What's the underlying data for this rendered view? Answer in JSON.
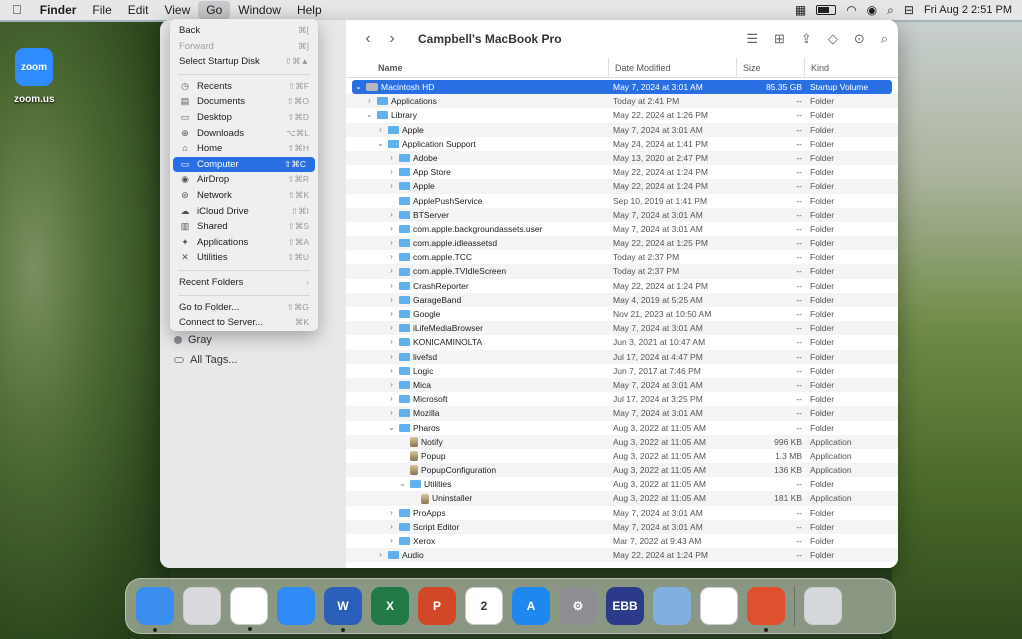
{
  "menubar": {
    "apple": "",
    "app": "Finder",
    "items": [
      "File",
      "Edit",
      "View",
      "Go",
      "Window",
      "Help"
    ],
    "clock": "Fri Aug 2  2:51 PM"
  },
  "desktop": {
    "zoom_icon": "zoom",
    "zoom_label": "zoom.us"
  },
  "go_menu": {
    "items": [
      {
        "label": "Back",
        "shortcut": "⌘[",
        "disabled": false
      },
      {
        "label": "Forward",
        "shortcut": "⌘]",
        "disabled": true
      },
      {
        "label": "Select Startup Disk",
        "shortcut": "⇧⌘▲",
        "disabled": false
      },
      {
        "label": "Recents",
        "shortcut": "⇧⌘F",
        "icon": "clock-icon"
      },
      {
        "label": "Documents",
        "shortcut": "⇧⌘O",
        "icon": "document-icon"
      },
      {
        "label": "Desktop",
        "shortcut": "⇧⌘D",
        "icon": "desktop-icon"
      },
      {
        "label": "Downloads",
        "shortcut": "⌥⌘L",
        "icon": "download-icon"
      },
      {
        "label": "Home",
        "shortcut": "⇧⌘H",
        "icon": "home-icon"
      },
      {
        "label": "Computer",
        "shortcut": "⇧⌘C",
        "icon": "computer-icon"
      },
      {
        "label": "AirDrop",
        "shortcut": "⇧⌘R",
        "icon": "airdrop-icon"
      },
      {
        "label": "Network",
        "shortcut": "⇧⌘K",
        "icon": "network-icon"
      },
      {
        "label": "iCloud Drive",
        "shortcut": "⇧⌘I",
        "icon": "cloud-icon"
      },
      {
        "label": "Shared",
        "shortcut": "⇧⌘S",
        "icon": "shared-icon"
      },
      {
        "label": "Applications",
        "shortcut": "⇧⌘A",
        "icon": "applications-icon"
      },
      {
        "label": "Utilities",
        "shortcut": "⇧⌘U",
        "icon": "utilities-icon"
      },
      {
        "label": "Recent Folders",
        "shortcut": "›"
      },
      {
        "label": "Go to Folder...",
        "shortcut": "⇧⌘G"
      },
      {
        "label": "Connect to Server...",
        "shortcut": "⌘K"
      }
    ]
  },
  "sidebar": {
    "tags": [
      {
        "label": "Gray"
      },
      {
        "label": "All Tags..."
      }
    ]
  },
  "finder": {
    "title": "Campbell's MacBook Pro",
    "columns": {
      "name": "Name",
      "date": "Date Modified",
      "size": "Size",
      "kind": "Kind"
    },
    "rows": [
      {
        "name": "Macintosh HD",
        "indent": 0,
        "chev": "⌄",
        "icon": "hd",
        "date": "May 7, 2024 at 3:01 AM",
        "size": "85.35 GB",
        "kind": "Startup Volume",
        "sel": true
      },
      {
        "name": "Applications",
        "indent": 1,
        "chev": "›",
        "icon": "folder",
        "date": "Today at 2:41 PM",
        "size": "--",
        "kind": "Folder"
      },
      {
        "name": "Library",
        "indent": 1,
        "chev": "⌄",
        "icon": "folder",
        "date": "May 22, 2024 at 1:26 PM",
        "size": "--",
        "kind": "Folder"
      },
      {
        "name": "Apple",
        "indent": 2,
        "chev": "›",
        "icon": "folder",
        "date": "May 7, 2024 at 3:01 AM",
        "size": "--",
        "kind": "Folder"
      },
      {
        "name": "Application Support",
        "indent": 2,
        "chev": "⌄",
        "icon": "folder",
        "date": "May 24, 2024 at 1:41 PM",
        "size": "--",
        "kind": "Folder"
      },
      {
        "name": "Adobe",
        "indent": 3,
        "chev": "›",
        "icon": "folder",
        "date": "May 13, 2020 at 2:47 PM",
        "size": "--",
        "kind": "Folder"
      },
      {
        "name": "App Store",
        "indent": 3,
        "chev": "›",
        "icon": "folder",
        "date": "May 22, 2024 at 1:24 PM",
        "size": "--",
        "kind": "Folder"
      },
      {
        "name": "Apple",
        "indent": 3,
        "chev": "›",
        "icon": "folder",
        "date": "May 22, 2024 at 1:24 PM",
        "size": "--",
        "kind": "Folder"
      },
      {
        "name": "ApplePushService",
        "indent": 3,
        "chev": "",
        "icon": "folder",
        "date": "Sep 10, 2019 at 1:41 PM",
        "size": "--",
        "kind": "Folder"
      },
      {
        "name": "BTServer",
        "indent": 3,
        "chev": "›",
        "icon": "folder",
        "date": "May 7, 2024 at 3:01 AM",
        "size": "--",
        "kind": "Folder"
      },
      {
        "name": "com.apple.backgroundassets.user",
        "indent": 3,
        "chev": "›",
        "icon": "folder",
        "date": "May 7, 2024 at 3:01 AM",
        "size": "--",
        "kind": "Folder"
      },
      {
        "name": "com.apple.idleassetsd",
        "indent": 3,
        "chev": "›",
        "icon": "folder",
        "date": "May 22, 2024 at 1:25 PM",
        "size": "--",
        "kind": "Folder"
      },
      {
        "name": "com.apple.TCC",
        "indent": 3,
        "chev": "›",
        "icon": "folder",
        "date": "Today at 2:37 PM",
        "size": "--",
        "kind": "Folder"
      },
      {
        "name": "com.apple.TVIdleScreen",
        "indent": 3,
        "chev": "›",
        "icon": "folder",
        "date": "Today at 2:37 PM",
        "size": "--",
        "kind": "Folder"
      },
      {
        "name": "CrashReporter",
        "indent": 3,
        "chev": "›",
        "icon": "folder",
        "date": "May 22, 2024 at 1:24 PM",
        "size": "--",
        "kind": "Folder"
      },
      {
        "name": "GarageBand",
        "indent": 3,
        "chev": "›",
        "icon": "folder",
        "date": "May 4, 2019 at 5:25 AM",
        "size": "--",
        "kind": "Folder"
      },
      {
        "name": "Google",
        "indent": 3,
        "chev": "›",
        "icon": "folder",
        "date": "Nov 21, 2023 at 10:50 AM",
        "size": "--",
        "kind": "Folder"
      },
      {
        "name": "iLifeMediaBrowser",
        "indent": 3,
        "chev": "›",
        "icon": "folder",
        "date": "May 7, 2024 at 3:01 AM",
        "size": "--",
        "kind": "Folder"
      },
      {
        "name": "KONICAMINOLTA",
        "indent": 3,
        "chev": "›",
        "icon": "folder",
        "date": "Jun 3, 2021 at 10:47 AM",
        "size": "--",
        "kind": "Folder"
      },
      {
        "name": "livefsd",
        "indent": 3,
        "chev": "›",
        "icon": "folder",
        "date": "Jul 17, 2024 at 4:47 PM",
        "size": "--",
        "kind": "Folder"
      },
      {
        "name": "Logic",
        "indent": 3,
        "chev": "›",
        "icon": "folder",
        "date": "Jun 7, 2017 at 7:46 PM",
        "size": "--",
        "kind": "Folder"
      },
      {
        "name": "Mica",
        "indent": 3,
        "chev": "›",
        "icon": "folder",
        "date": "May 7, 2024 at 3:01 AM",
        "size": "--",
        "kind": "Folder"
      },
      {
        "name": "Microsoft",
        "indent": 3,
        "chev": "›",
        "icon": "folder",
        "date": "Jul 17, 2024 at 3:25 PM",
        "size": "--",
        "kind": "Folder"
      },
      {
        "name": "Mozilla",
        "indent": 3,
        "chev": "›",
        "icon": "folder",
        "date": "May 7, 2024 at 3:01 AM",
        "size": "--",
        "kind": "Folder"
      },
      {
        "name": "Pharos",
        "indent": 3,
        "chev": "⌄",
        "icon": "folder",
        "date": "Aug 3, 2022 at 11:05 AM",
        "size": "--",
        "kind": "Folder"
      },
      {
        "name": "Notify",
        "indent": 4,
        "chev": "",
        "icon": "app",
        "date": "Aug 3, 2022 at 11:05 AM",
        "size": "996 KB",
        "kind": "Application"
      },
      {
        "name": "Popup",
        "indent": 4,
        "chev": "",
        "icon": "app",
        "date": "Aug 3, 2022 at 11:05 AM",
        "size": "1.3 MB",
        "kind": "Application"
      },
      {
        "name": "PopupConfiguration",
        "indent": 4,
        "chev": "",
        "icon": "app",
        "date": "Aug 3, 2022 at 11:05 AM",
        "size": "136 KB",
        "kind": "Application"
      },
      {
        "name": "Utilities",
        "indent": 4,
        "chev": "⌄",
        "icon": "folder",
        "date": "Aug 3, 2022 at 11:05 AM",
        "size": "--",
        "kind": "Folder"
      },
      {
        "name": "Uninstaller",
        "indent": 5,
        "chev": "",
        "icon": "app",
        "date": "Aug 3, 2022 at 11:05 AM",
        "size": "181 KB",
        "kind": "Application"
      },
      {
        "name": "ProApps",
        "indent": 3,
        "chev": "›",
        "icon": "folder",
        "date": "May 7, 2024 at 3:01 AM",
        "size": "--",
        "kind": "Folder"
      },
      {
        "name": "Script Editor",
        "indent": 3,
        "chev": "›",
        "icon": "folder",
        "date": "May 7, 2024 at 3:01 AM",
        "size": "--",
        "kind": "Folder"
      },
      {
        "name": "Xerox",
        "indent": 3,
        "chev": "›",
        "icon": "folder",
        "date": "Mar 7, 2022 at 9:43 AM",
        "size": "--",
        "kind": "Folder"
      },
      {
        "name": "Audio",
        "indent": 2,
        "chev": "›",
        "icon": "folder",
        "date": "May 22, 2024 at 1:24 PM",
        "size": "--",
        "kind": "Folder"
      }
    ]
  },
  "dock": {
    "apps": [
      {
        "name": "finder-app",
        "label": "",
        "color": "#3a8ef0",
        "running": true
      },
      {
        "name": "launchpad-app",
        "label": "",
        "color": "#d9d9de",
        "running": false
      },
      {
        "name": "chrome-app",
        "label": "",
        "color": "#ffffff",
        "running": true
      },
      {
        "name": "safari-app",
        "label": "",
        "color": "#2f8bf5",
        "running": false
      },
      {
        "name": "word-app",
        "label": "W",
        "color": "#2b5fb9",
        "running": true
      },
      {
        "name": "excel-app",
        "label": "X",
        "color": "#1f7a45",
        "running": false
      },
      {
        "name": "powerpoint-app",
        "label": "P",
        "color": "#d24726",
        "running": false
      },
      {
        "name": "calendar-app",
        "label": "2",
        "color": "#ffffff",
        "running": false
      },
      {
        "name": "app-store-app",
        "label": "A",
        "color": "#1e88f0",
        "running": false
      },
      {
        "name": "system-settings-app",
        "label": "⚙",
        "color": "#8e8e93",
        "running": false
      },
      {
        "name": "ebb-app",
        "label": "EBB",
        "color": "#2b3a8a",
        "running": false
      },
      {
        "name": "network-utility-app",
        "label": "",
        "color": "#7fb0e0",
        "running": false
      },
      {
        "name": "freeform-app",
        "label": "",
        "color": "#ffffff",
        "running": false
      },
      {
        "name": "remote-desktop-app",
        "label": "",
        "color": "#e0502e",
        "running": true
      },
      {
        "name": "trash-app",
        "label": "",
        "color": "#d6d9dc",
        "running": false
      }
    ]
  }
}
